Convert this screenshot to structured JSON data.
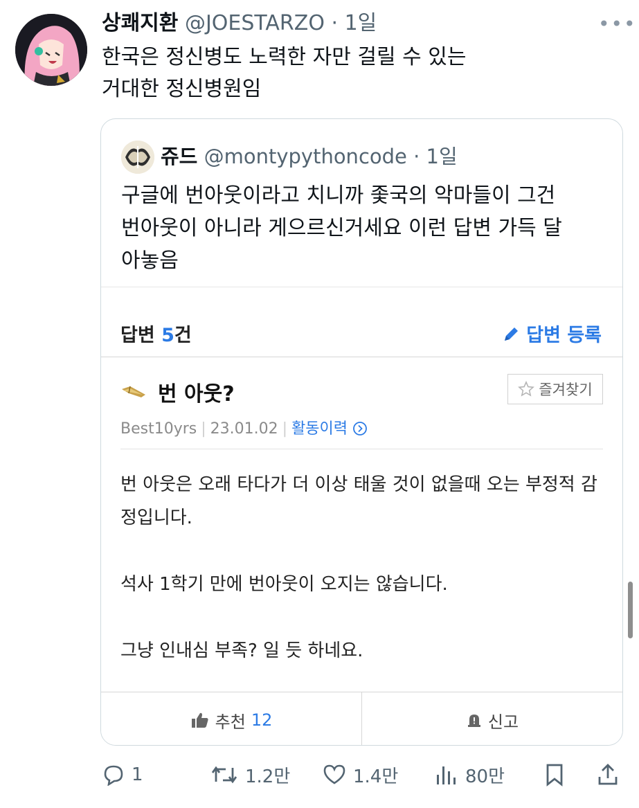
{
  "tweet": {
    "display_name": "상쾌지환",
    "handle": "@JOESTARZO",
    "time": "1일",
    "text_line1": "한국은 정신병도 노력한 자만 걸릴 수 있는",
    "text_line2": "거대한 정신병원임"
  },
  "quoted": {
    "display_name": "쥬드",
    "handle": "@montypythoncode",
    "time": "1일",
    "text_line1": "구글에 번아웃이라고 치니까 좇국의 악마들이 그건",
    "text_line2": "번아웃이 아니라 게으르신거세요 이런 답변 가득 달",
    "text_line3": "아놓음"
  },
  "answers": {
    "count_label": "답변",
    "count": "5",
    "count_suffix": "건",
    "register_label": "답변 등록",
    "title": "번 아웃?",
    "favorite_label": "즐겨찾기",
    "author": "Best10yrs",
    "date": "23.01.02",
    "activity_label": "활동이력",
    "body": [
      "번 아웃은 오래 타다가 더 이상 태울 것이 없을때 오는 부정적 감정입니다.",
      "석사 1학기 만에 번아웃이 오지는 않습니다.",
      "그냥 인내심 부족? 일 듯 하네요."
    ],
    "recommend_label": "추천",
    "recommend_count": "12",
    "report_label": "신고"
  },
  "actions": {
    "replies": "1",
    "retweets": "1.2만",
    "likes": "1.4만",
    "views": "80만"
  },
  "colors": {
    "accent_blue": "#2c7be5",
    "secondary_text": "#536471",
    "border": "#cfd9de"
  }
}
